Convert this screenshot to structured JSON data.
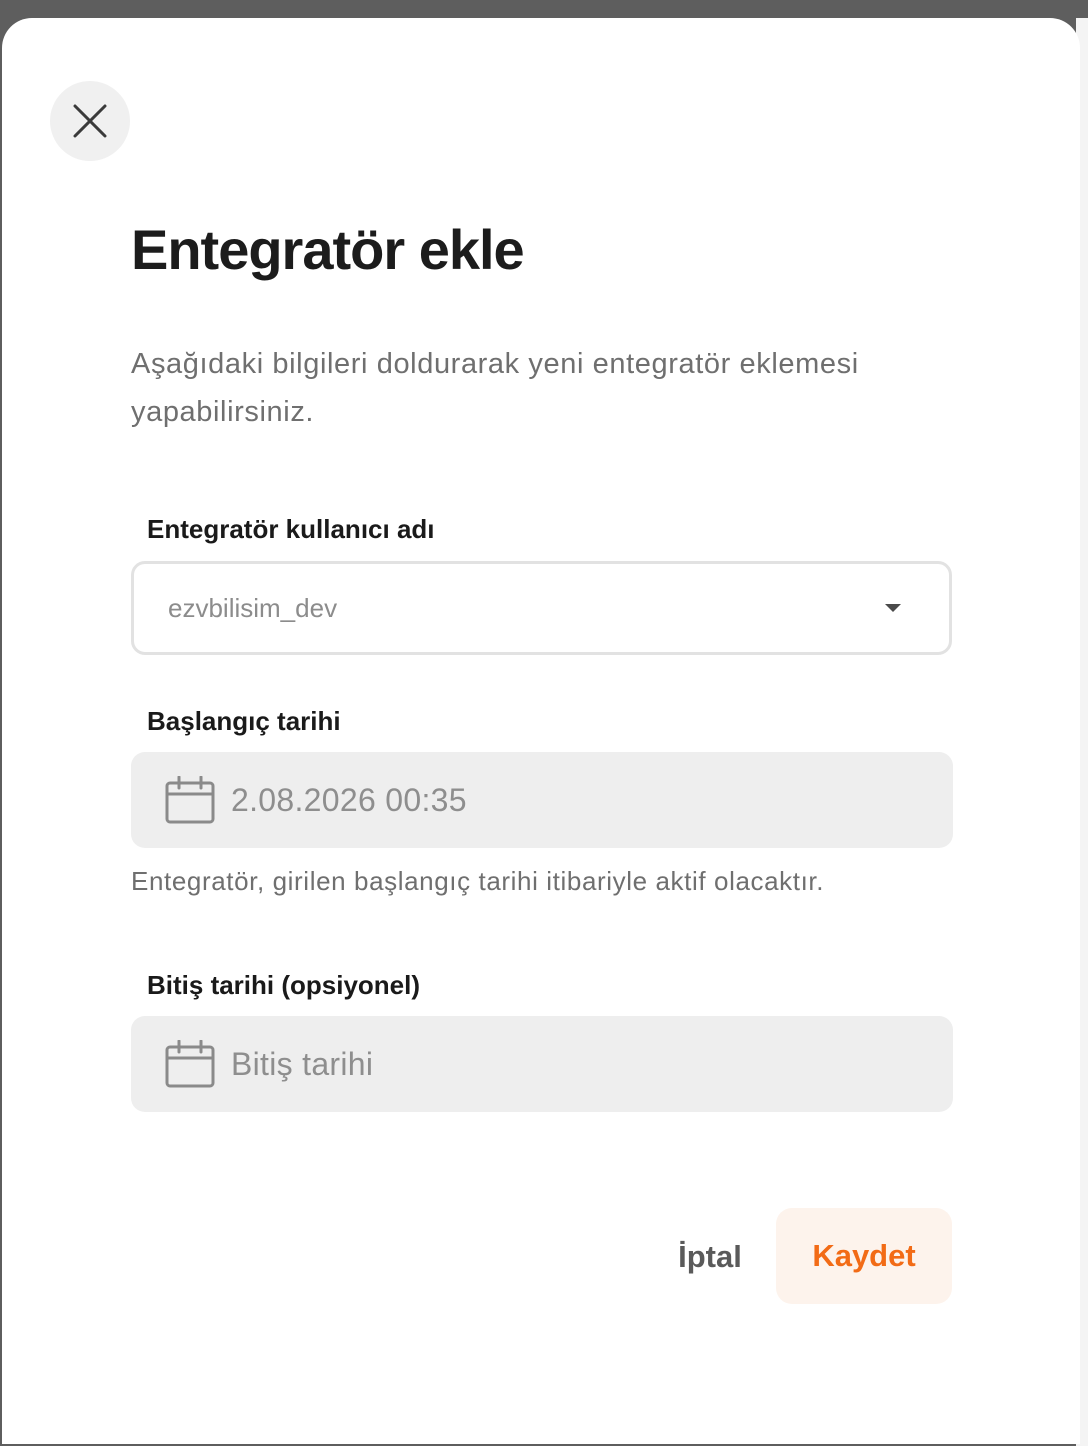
{
  "dialog": {
    "title": "Entegratör ekle",
    "description": "Aşağıdaki bilgileri doldurarak yeni entegratör eklemesi yapabilirsiniz.",
    "close_icon": "close-icon"
  },
  "form": {
    "username": {
      "label": "Entegratör kullanıcı adı",
      "value": "ezvbilisim_dev",
      "icon": "caret-down-icon"
    },
    "start_date": {
      "label": "Başlangıç tarihi",
      "value": "2.08.2026 00:35",
      "hint": "Entegratör, girilen başlangıç tarihi itibariyle aktif olacaktır.",
      "icon": "calendar-icon"
    },
    "end_date": {
      "label": "Bitiş tarihi (opsiyonel)",
      "placeholder": "Bitiş tarihi",
      "icon": "calendar-icon"
    }
  },
  "actions": {
    "cancel_label": "İptal",
    "save_label": "Kaydet"
  },
  "colors": {
    "accent": "#f26b16",
    "accent_bg": "#fdf3ec",
    "field_bg": "#eeeeee"
  }
}
